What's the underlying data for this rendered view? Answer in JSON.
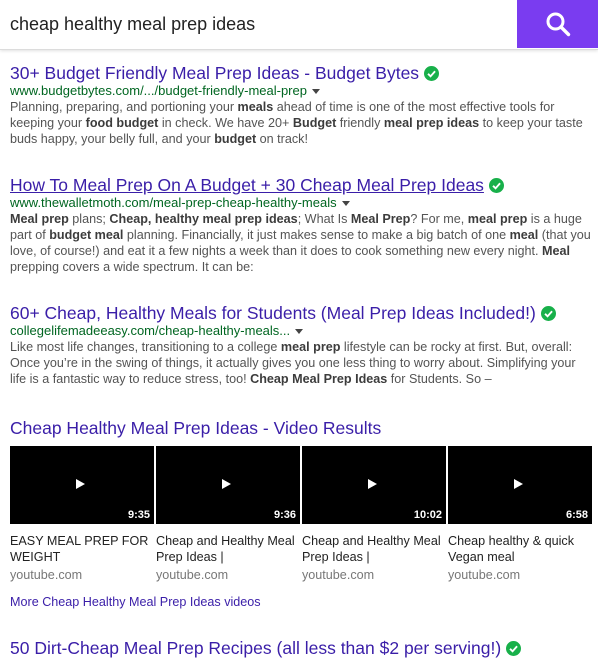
{
  "search": {
    "query": "cheap healthy meal prep ideas",
    "button_icon": "search-icon"
  },
  "results": [
    {
      "title": "30+ Budget Friendly Meal Prep Ideas - Budget Bytes",
      "url": "www.budgetbytes.com/.../budget-friendly-meal-prep",
      "snippet": [
        {
          "t": "Planning, preparing, and portioning your "
        },
        {
          "t": "meals",
          "b": true
        },
        {
          "t": " ahead of time is one of the most effective tools for keeping your "
        },
        {
          "t": "food budget",
          "b": true
        },
        {
          "t": " in check. We have 20+ "
        },
        {
          "t": "Budget",
          "b": true
        },
        {
          "t": " friendly "
        },
        {
          "t": "meal prep ideas",
          "b": true
        },
        {
          "t": " to keep your taste buds happy, your belly full, and your "
        },
        {
          "t": "budget",
          "b": true
        },
        {
          "t": " on track!"
        }
      ]
    },
    {
      "title": "How To Meal Prep On A Budget + 30 Cheap Meal Prep Ideas",
      "url": "www.thewalletmoth.com/meal-prep-cheap-healthy-meals",
      "snippet": [
        {
          "t": "Meal prep",
          "b": true
        },
        {
          "t": " plans; "
        },
        {
          "t": "Cheap, healthy meal prep ideas",
          "b": true
        },
        {
          "t": "; What Is "
        },
        {
          "t": "Meal Prep",
          "b": true
        },
        {
          "t": "? For me, "
        },
        {
          "t": "meal prep",
          "b": true
        },
        {
          "t": " is a huge part of "
        },
        {
          "t": "budget meal",
          "b": true
        },
        {
          "t": " planning. Financially, it just makes sense to make a big batch of one "
        },
        {
          "t": "meal",
          "b": true
        },
        {
          "t": " (that you love, of course!) and eat it a few nights a week than it does to cook something new every night. "
        },
        {
          "t": "Meal",
          "b": true
        },
        {
          "t": " prepping covers a wide spectrum. It can be:"
        }
      ]
    },
    {
      "title": "60+ Cheap, Healthy Meals for Students (Meal Prep Ideas Included!)",
      "url": "collegelifemadeeasy.com/cheap-healthy-meals...",
      "snippet": [
        {
          "t": "Like most life changes, transitioning to a college "
        },
        {
          "t": "meal prep",
          "b": true
        },
        {
          "t": " lifestyle can be rocky at first. But, overall: Once you’re in the swing of things, it actually gives you one less thing to worry about. Simplifying your life is a fantastic way to reduce stress, too! "
        },
        {
          "t": "Cheap Meal Prep Ideas",
          "b": true
        },
        {
          "t": " for Students. So –"
        }
      ]
    }
  ],
  "video_section": {
    "title": "Cheap Healthy Meal Prep Ideas - Video Results",
    "videos": [
      {
        "duration": "9:35",
        "title": "EASY MEAL PREP FOR WEIGHT",
        "source": "youtube.com"
      },
      {
        "duration": "9:36",
        "title": "Cheap and Healthy Meal Prep Ideas |",
        "source": "youtube.com"
      },
      {
        "duration": "10:02",
        "title": "Cheap and Healthy Meal Prep Ideas |",
        "source": "youtube.com"
      },
      {
        "duration": "6:58",
        "title": "Cheap healthy & quick Vegan meal",
        "source": "youtube.com"
      }
    ],
    "more_link": "More Cheap Healthy Meal Prep Ideas videos"
  },
  "last_result": {
    "title": "50 Dirt-Cheap Meal Prep Recipes (all less than $2 per serving!)"
  },
  "colors": {
    "accent": "#7a3cf0",
    "link": "#3a1ea8",
    "url": "#006621",
    "verified": "#18b04a"
  }
}
